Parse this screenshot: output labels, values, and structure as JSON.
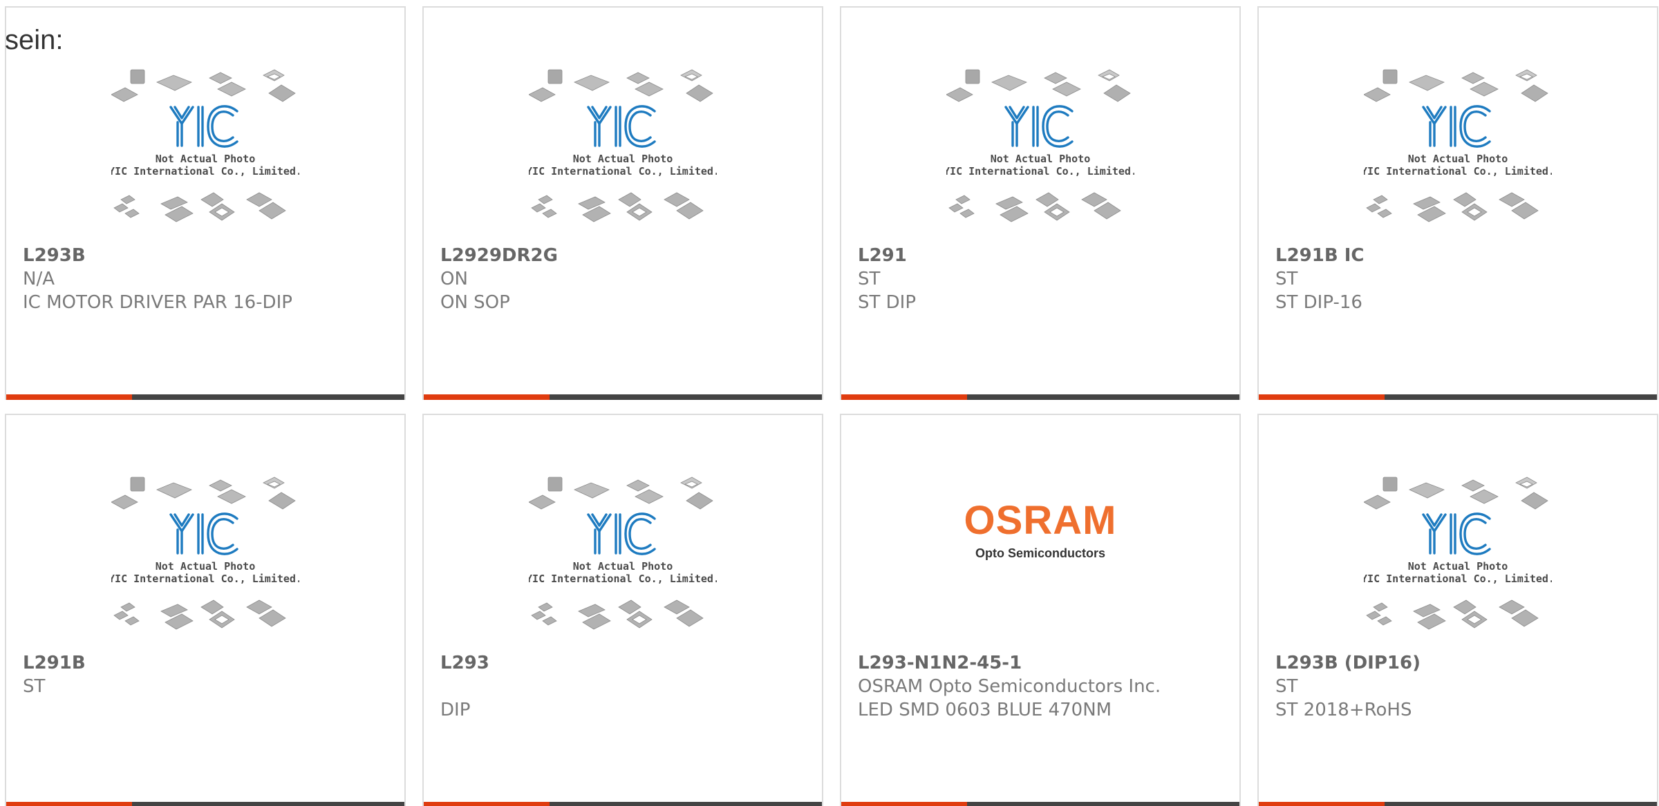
{
  "intro_text": "sein:",
  "accent_color": "#e03c0f",
  "bar_color": "#444444",
  "placeholder": {
    "caption_line1": "Not Actual Photo",
    "caption_line2": "YIC International Co., Limited.",
    "logo_text": "YIC"
  },
  "products": [
    {
      "part_number": "L293B",
      "manufacturer": "N/A",
      "description": "IC MOTOR DRIVER PAR 16-DIP",
      "image": "yic-placeholder"
    },
    {
      "part_number": "L2929DR2G",
      "manufacturer": "ON",
      "description": "ON SOP",
      "image": "yic-placeholder"
    },
    {
      "part_number": "L291",
      "manufacturer": "ST",
      "description": "ST DIP",
      "image": "yic-placeholder"
    },
    {
      "part_number": "L291B IC",
      "manufacturer": "ST",
      "description": "ST DIP-16",
      "image": "yic-placeholder"
    },
    {
      "part_number": "L291B",
      "manufacturer": "ST",
      "description": "",
      "image": "yic-placeholder"
    },
    {
      "part_number": "L293",
      "manufacturer": "",
      "description": "DIP",
      "image": "yic-placeholder"
    },
    {
      "part_number": "L293-N1N2-45-1",
      "manufacturer": "OSRAM Opto Semiconductors Inc.",
      "description": "LED SMD 0603 BLUE 470NM",
      "image": "osram-logo",
      "logo_title": "OSRAM",
      "logo_subtitle": "Opto Semiconductors"
    },
    {
      "part_number": "L293B (DIP16)",
      "manufacturer": "ST",
      "description": "ST 2018+RoHS",
      "image": "yic-placeholder"
    }
  ]
}
